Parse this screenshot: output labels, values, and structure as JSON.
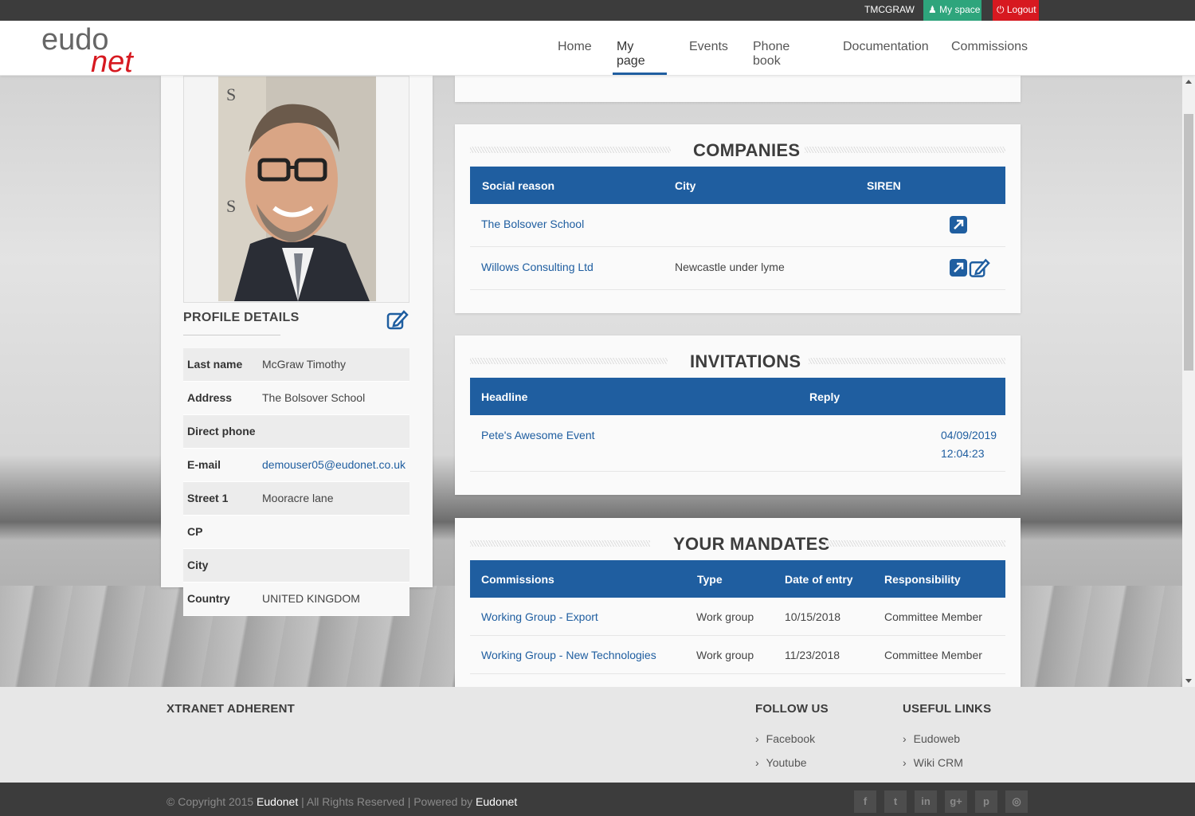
{
  "topbar": {
    "username": "TMCGRAW",
    "myspace": "My space",
    "logout": "Logout"
  },
  "brand": {
    "logo_part1": "eudo",
    "logo_part2": "net"
  },
  "nav": {
    "items": [
      "Home",
      "My page",
      "Events",
      "Phone book",
      "Documentation",
      "Commissions"
    ],
    "active": "My page"
  },
  "profile": {
    "title": "PROFILE DETAILS",
    "fields": [
      {
        "label": "Last name",
        "value": "McGraw Timothy"
      },
      {
        "label": "Address",
        "value": "The Bolsover School"
      },
      {
        "label": "Direct phone",
        "value": ""
      },
      {
        "label": "E-mail",
        "value": "demouser05@eudonet.co.uk"
      },
      {
        "label": "Street 1",
        "value": "Mooracre lane"
      },
      {
        "label": "CP",
        "value": ""
      },
      {
        "label": "City",
        "value": ""
      },
      {
        "label": "Country",
        "value": "UNITED KINGDOM"
      }
    ]
  },
  "companies": {
    "title": "COMPANIES",
    "columns": [
      "Social reason",
      "City",
      "SIREN"
    ],
    "rows": [
      {
        "name": "The Bolsover School",
        "city": "",
        "siren": ""
      },
      {
        "name": "Willows Consulting Ltd",
        "city": "Newcastle under lyme",
        "siren": ""
      }
    ]
  },
  "invitations": {
    "title": "INVITATIONS",
    "columns": [
      "Headline",
      "Reply"
    ],
    "rows": [
      {
        "headline": "Pete's Awesome Event",
        "date": "04/09/2019",
        "time": "12:04:23"
      }
    ]
  },
  "mandates": {
    "title": "YOUR MANDATES",
    "columns": [
      "Commissions",
      "Type",
      "Date of entry",
      "Responsibility"
    ],
    "rows": [
      {
        "commission": "Working Group - Export",
        "type": "Work group",
        "date": "10/15/2018",
        "responsibility": "Committee Member"
      },
      {
        "commission": "Working Group - New Technologies",
        "type": "Work group",
        "date": "11/23/2018",
        "responsibility": "Committee Member"
      }
    ]
  },
  "footer": {
    "col1_title": "XTRANET ADHERENT",
    "col2_title": "FOLLOW US",
    "follow": [
      "Facebook",
      "Youtube"
    ],
    "col3_title": "USEFUL LINKS",
    "links": [
      "Eudoweb",
      "Wiki CRM"
    ],
    "copyright_pre": "© Copyright 2015",
    "brand1": "Eudonet",
    "copyright_mid": "| All Rights Reserved | Powered by",
    "brand2": "Eudonet",
    "social_icons": [
      "facebook-icon",
      "twitter-icon",
      "linkedin-icon",
      "google-plus-icon",
      "pinterest-icon",
      "dribbble-icon"
    ]
  },
  "colors": {
    "primary": "#1f5ea0",
    "myspace": "#2ea57c",
    "logout": "#d71920",
    "logo_red": "#d71920"
  }
}
